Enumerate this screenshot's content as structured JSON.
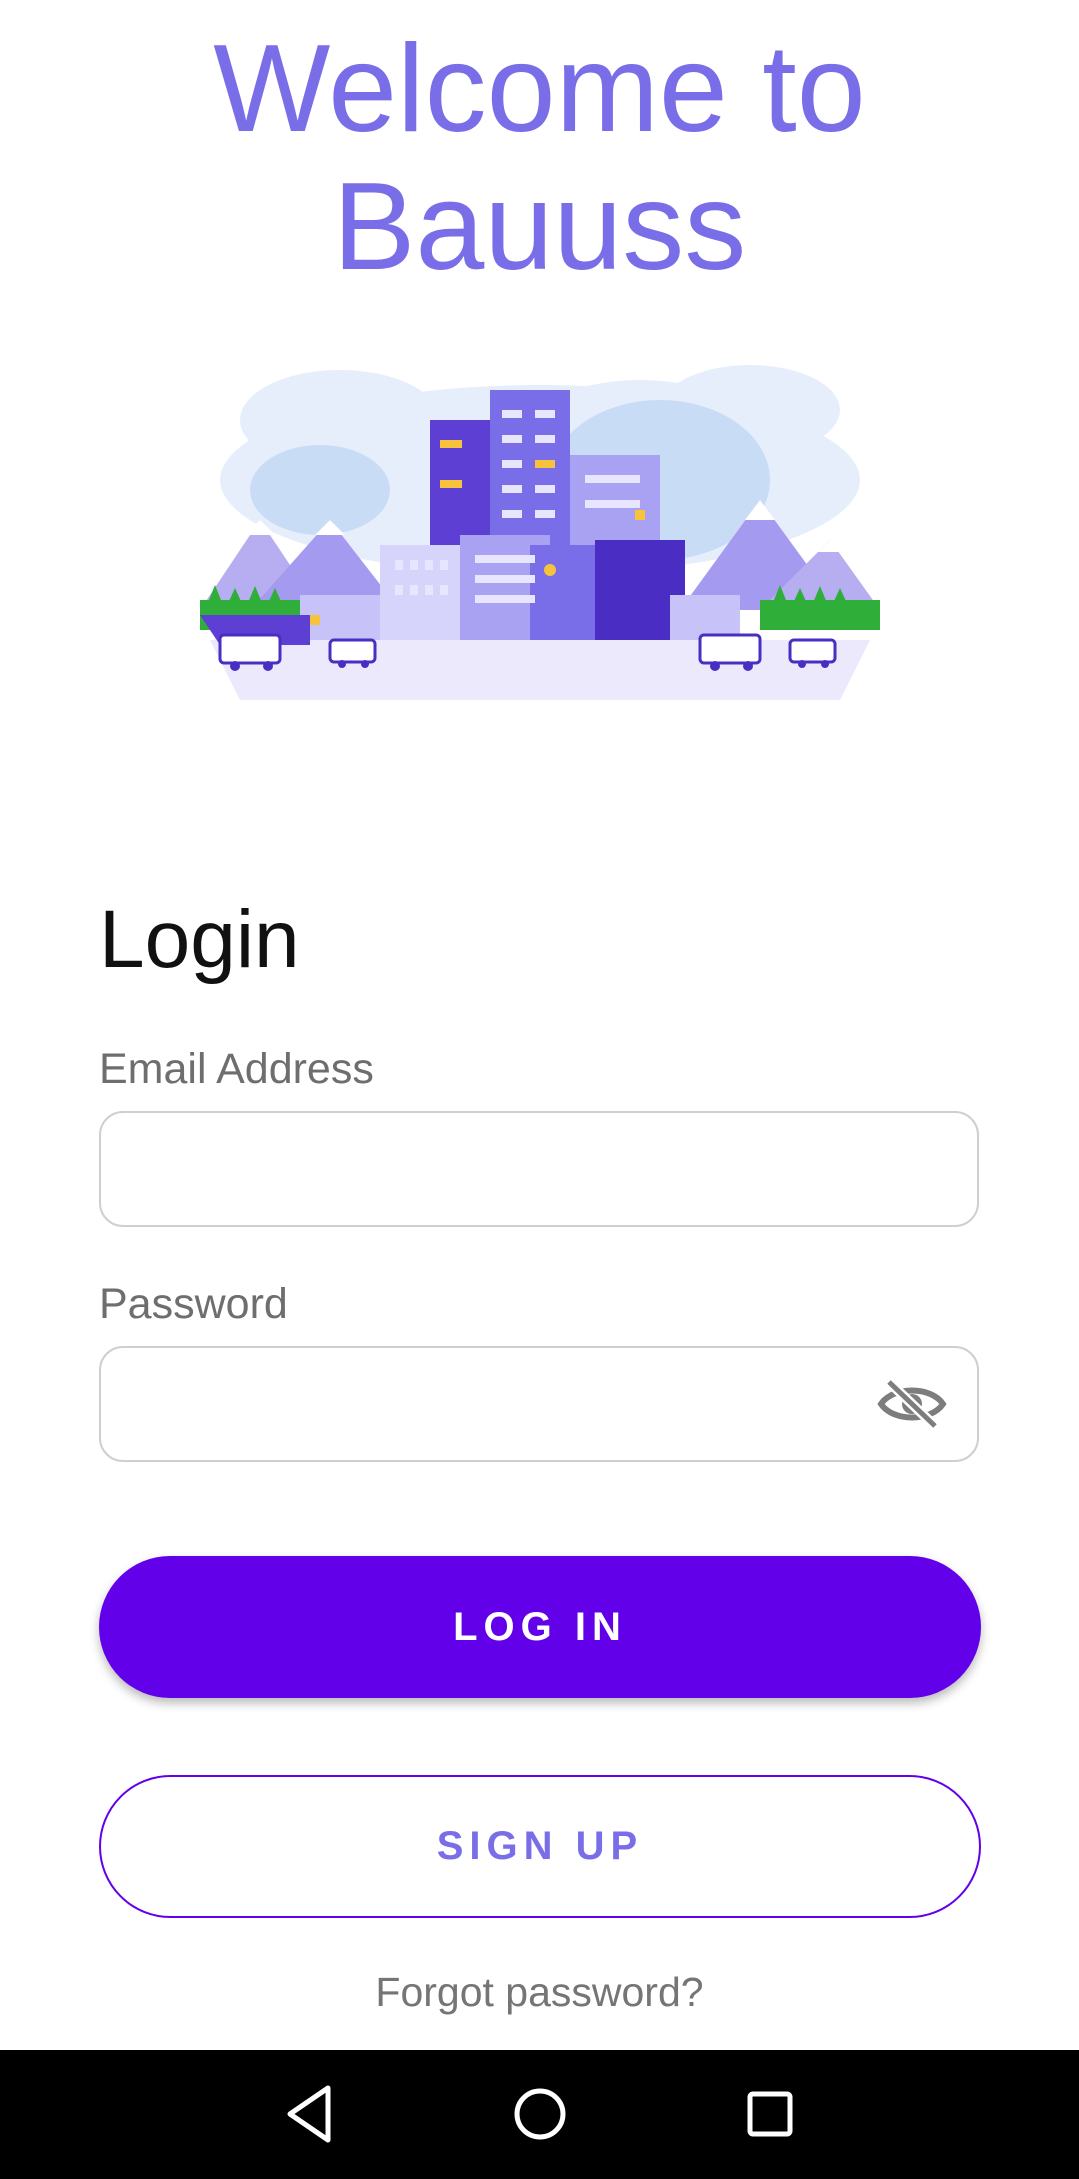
{
  "header": {
    "welcome_line1": "Welcome to",
    "welcome_line2": "Bauuss"
  },
  "form": {
    "title": "Login",
    "email_label": "Email Address",
    "email_value": "",
    "password_label": "Password",
    "password_value": "",
    "password_toggle_icon": "eye-off-icon",
    "login_button": "LOG IN",
    "signup_button": "SIGN UP",
    "forgot_link": "Forgot password?"
  },
  "navbar": {
    "icons": [
      "back-triangle-icon",
      "home-circle-icon",
      "recents-square-icon"
    ]
  },
  "colors": {
    "accent": "#6200ea",
    "title": "#7a6ee8",
    "label": "#6e6e6e",
    "field_border": "#cfcfcf"
  }
}
